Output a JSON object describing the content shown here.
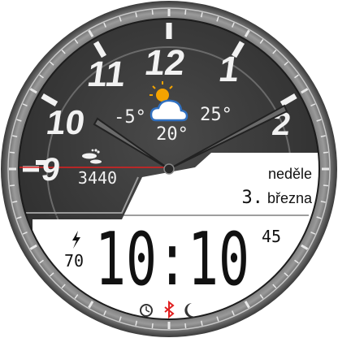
{
  "dial": {
    "hours": [
      "12",
      "1",
      "2",
      "9",
      "10",
      "11"
    ]
  },
  "weather": {
    "icon": "partly-sunny-icon",
    "low": "-5°",
    "high": "25°",
    "current": "20°"
  },
  "steps": {
    "icon": "footprints-icon",
    "count": "3440"
  },
  "date": {
    "weekday": "neděle",
    "day": "3.",
    "month": "března"
  },
  "battery": {
    "icon": "lightning-icon",
    "level": "70"
  },
  "time": {
    "hhmm": "10:10",
    "seconds": "45"
  },
  "status": {
    "alarm_icon": "alarm-clock-icon",
    "bluetooth_icon": "bluetooth-icon",
    "night_icon": "moon-icon"
  },
  "colors": {
    "dial_dark": "#3c3c3c",
    "accent_red": "#e02020",
    "bluetooth": "#e02020",
    "white_panel": "#ffffff"
  }
}
